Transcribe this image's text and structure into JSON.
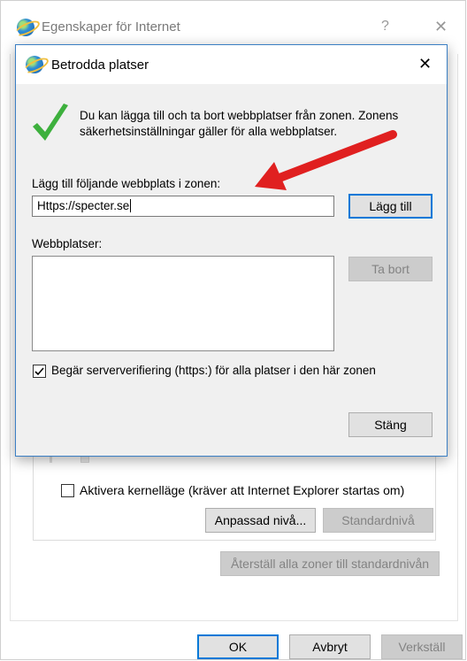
{
  "outer_window": {
    "title": "Egenskaper för Internet",
    "help_glyph": "?",
    "close_glyph": "✕",
    "kernel_mode_label": "Aktivera kernelläge (kräver att Internet Explorer startas om)",
    "custom_level_label": "Anpassad nivå...",
    "default_level_label": "Standardnivå",
    "reset_all_label": "Återställ alla zoner till standardnivån",
    "ok_label": "OK",
    "cancel_label": "Avbryt",
    "apply_label": "Verkställ"
  },
  "dialog": {
    "title": "Betrodda platser",
    "close_glyph": "✕",
    "info_text": "Du kan lägga till och ta bort webbplatser från zonen. Zonens säkerhetsinställningar gäller för alla webbplatser.",
    "add_label": "Lägg till följande webbplats i zonen:",
    "add_input_value": "Https://specter.se",
    "add_button_label": "Lägg till",
    "websites_label": "Webbplatser:",
    "remove_button_label": "Ta bort",
    "require_https_label": "Begär serververifiering (https:) för alla platser i den här zonen",
    "require_https_checked": true,
    "close_button_label": "Stäng"
  },
  "colors": {
    "accent": "#0078d7",
    "arrow": "#e02020",
    "check": "#3db03d"
  }
}
